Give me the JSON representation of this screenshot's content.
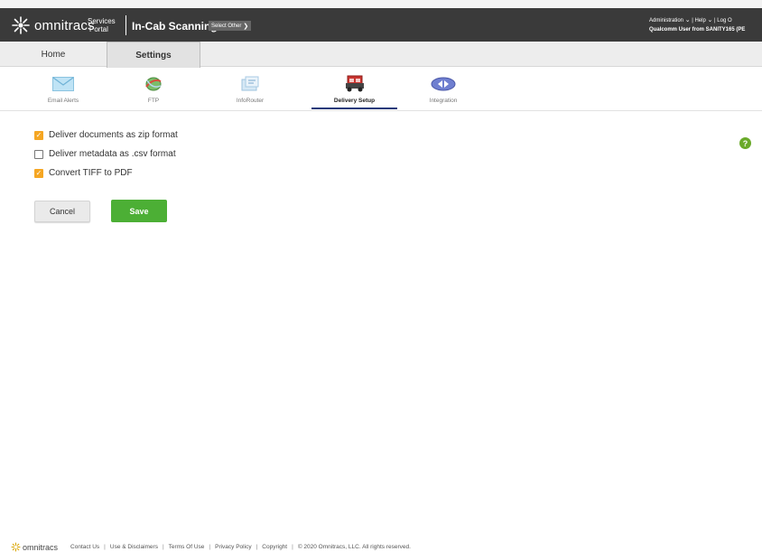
{
  "brand": {
    "name": "omnitracs",
    "services_line1": "Services",
    "services_line2": "Portal",
    "app_title": "In-Cab Scanning",
    "select_other": "Select Other"
  },
  "topbar": {
    "admin_label": "Administration",
    "help_label": "Help",
    "logout_label": "Log O",
    "user_line": "Qualcomm User from SANITY165  (PE"
  },
  "tabs": [
    {
      "label": "Home"
    },
    {
      "label": "Settings",
      "active": true
    }
  ],
  "iconbar": [
    {
      "label": "Email Alerts",
      "icon": "envelope-icon"
    },
    {
      "label": "FTP",
      "icon": "ftp-icon"
    },
    {
      "label": "InfoRouter",
      "icon": "inforouter-icon"
    },
    {
      "label": "Delivery Setup",
      "icon": "truck-icon",
      "active": true
    },
    {
      "label": "Integration",
      "icon": "integration-icon"
    }
  ],
  "options": [
    {
      "label": "Deliver documents as zip format",
      "checked": true
    },
    {
      "label": "Deliver metadata as .csv format",
      "checked": false
    },
    {
      "label": "Convert TIFF to PDF",
      "checked": true
    }
  ],
  "buttons": {
    "cancel": "Cancel",
    "save": "Save"
  },
  "help_glyph": "?",
  "footer": {
    "logo": "omnitracs",
    "links": [
      "Contact Us",
      "Use & Disclaimers",
      "Terms Of Use",
      "Privacy Policy",
      "Copyright",
      "© 2020 Omnitracs, LLC. All rights reserved."
    ]
  },
  "colors": {
    "topbar": "#3a3a3a",
    "checkbox": "#f5a623",
    "save": "#4caf35",
    "active_tab_line": "#213a7a",
    "help": "#6aaa2a"
  }
}
